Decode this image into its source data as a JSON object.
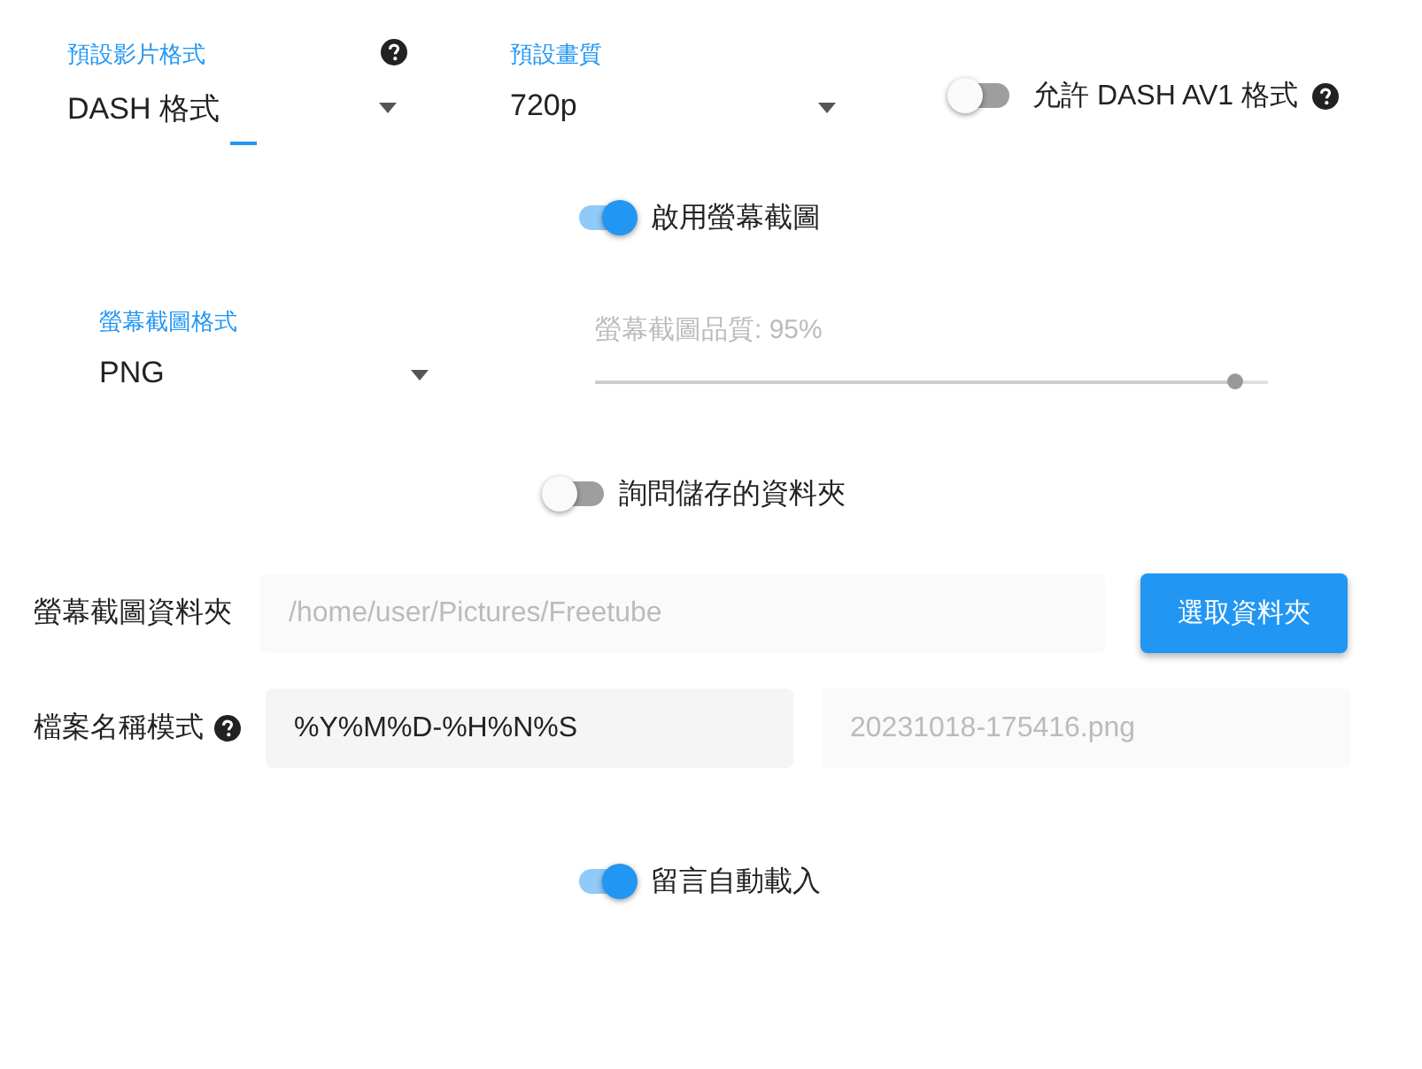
{
  "video_format": {
    "label": "預設影片格式",
    "value": "DASH 格式",
    "focused": true,
    "help": true
  },
  "quality": {
    "label": "預設畫質",
    "value": "720p"
  },
  "av1_toggle": {
    "label": "允許 DASH AV1 格式",
    "on": false,
    "help": true
  },
  "screenshot_toggle": {
    "label": "啟用螢幕截圖",
    "on": true
  },
  "screenshot_format": {
    "label": "螢幕截圖格式",
    "value": "PNG"
  },
  "screenshot_quality": {
    "label": "螢幕截圖品質: 95%",
    "level": 0.95,
    "disabled": true
  },
  "ask_folder_toggle": {
    "label": "詢問儲存的資料夾",
    "on": false
  },
  "folder": {
    "label": "螢幕截圖資料夾",
    "placeholder": "/home/user/Pictures/Freetube",
    "button": "選取資料夾"
  },
  "filename": {
    "label": "檔案名稱模式",
    "help": true,
    "value": "%Y%M%D-%H%N%S",
    "preview_placeholder": "20231018-175416.png"
  },
  "comments_toggle": {
    "label": "留言自動載入",
    "on": true
  }
}
